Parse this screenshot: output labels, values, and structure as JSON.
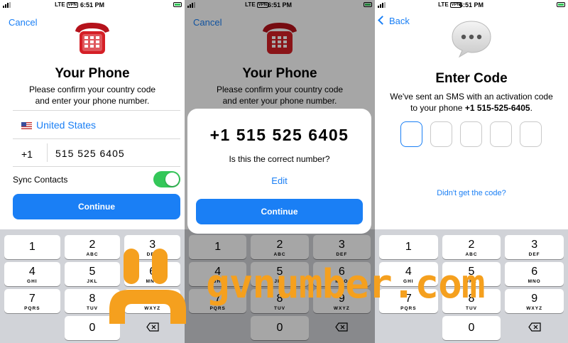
{
  "screen1": {
    "status": {
      "carrier": "LTE",
      "vpn": "VPN",
      "time": "6:51 PM"
    },
    "cancel_label": "Cancel",
    "title": "Your Phone",
    "subtitle_line1": "Please confirm your country code",
    "subtitle_line2": "and enter your phone number.",
    "country": "United States",
    "country_code": "+1",
    "phone_number": "515 525 6405",
    "sync_label": "Sync Contacts",
    "sync_enabled": true,
    "continue_label": "Continue"
  },
  "screen2": {
    "status": {
      "carrier": "LTE",
      "vpn": "VPN",
      "time": "6:51 PM"
    },
    "cancel_label": "Cancel",
    "title": "Your Phone",
    "subtitle_line1": "Please confirm your country code",
    "subtitle_line2": "and enter your phone number.",
    "dialog": {
      "number": "+1 515 525 6405",
      "question": "Is this the correct number?",
      "edit_label": "Edit",
      "continue_label": "Continue"
    }
  },
  "screen3": {
    "status": {
      "carrier": "LTE",
      "vpn": "VPN",
      "time": "6:51 PM"
    },
    "back_label": "Back",
    "title": "Enter Code",
    "sms_line1": "We've sent an SMS with an activation code",
    "sms_line2_prefix": "to your phone ",
    "sms_phone": "+1 515-525-6405",
    "sms_line2_suffix": ".",
    "code_digits": 5,
    "didnt_get_label": "Didn't get the code?"
  },
  "keypad": {
    "keys": [
      {
        "digit": "1",
        "letters": ""
      },
      {
        "digit": "2",
        "letters": "ABC"
      },
      {
        "digit": "3",
        "letters": "DEF"
      },
      {
        "digit": "4",
        "letters": "GHI"
      },
      {
        "digit": "5",
        "letters": "JKL"
      },
      {
        "digit": "6",
        "letters": "MNO"
      },
      {
        "digit": "7",
        "letters": "PQRS"
      },
      {
        "digit": "8",
        "letters": "TUV"
      },
      {
        "digit": "9",
        "letters": "WXYZ"
      },
      {
        "digit": "0",
        "letters": ""
      }
    ]
  },
  "watermark": "gvnumber.com",
  "colors": {
    "accent": "#1a7ff5",
    "toggle_on": "#34c759",
    "watermark": "#f5a01e"
  }
}
